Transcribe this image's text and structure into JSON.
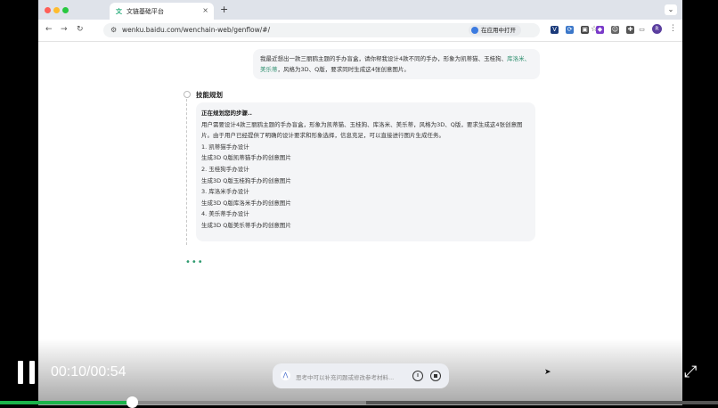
{
  "browser": {
    "tab_title": "文链基础平台",
    "tab_icon": "文",
    "tab_close": "×",
    "new_tab": "+",
    "window_menu": "⌄",
    "url": "wenku.baidu.com/wenchain-web/genflow/#/",
    "open_in_app": "在应用中打开",
    "back": "←",
    "forward": "→",
    "reload": "↻",
    "star": "☆",
    "avatar": "R",
    "kebab": "⋮"
  },
  "chat": {
    "user_message_prefix": "我最近想出一款三丽鸥主题的手办盲盒，请你帮我设计4款不同的手办，形象为凯蒂猫、玉桂狗、",
    "user_message_hl": "库洛米、美乐蒂",
    "user_message_suffix": "，风格为3D、Q版，要求同时生成这4张创意图片。",
    "plan_title": "技能规划",
    "plan_subtitle": "正在规划您的步骤..",
    "plan_intro": "用户需要设计4款三丽鸥主题的手办盲盒，形象为凯蒂猫、玉桂狗、库洛米、美乐蒂，风格为3D、Q版，要求生成这4张创意图片。由于用户已经提供了明确的设计要求和形象选择，信息充足，可以直接进行图片生成任务。",
    "steps": [
      "1. 凯蒂猫手办设计",
      "生成3D Q版凯蒂猫手办的创意图片",
      "2. 玉桂狗手办设计",
      "生成3D Q版玉桂狗手办的创意图片",
      "3. 库洛米手办设计",
      "生成3D Q版库洛米手办的创意图片",
      "4. 美乐蒂手办设计",
      "生成3D Q版美乐蒂手办的创意图片"
    ],
    "typing": "•••",
    "input_placeholder": "思考中可以补充问题或修改参考材料...",
    "input_pause": "II"
  },
  "player": {
    "current_time": "00:10",
    "duration": "00:54",
    "time_display": "00:10/00:54",
    "progress_fraction": 0.185,
    "buffered_fraction": 0.51,
    "fullscreen_icon": "⤢"
  },
  "colors": {
    "accent_green": "#2f9a6f",
    "progress_green": "#1bb34a",
    "browser_chrome": "#dfe3ea"
  }
}
